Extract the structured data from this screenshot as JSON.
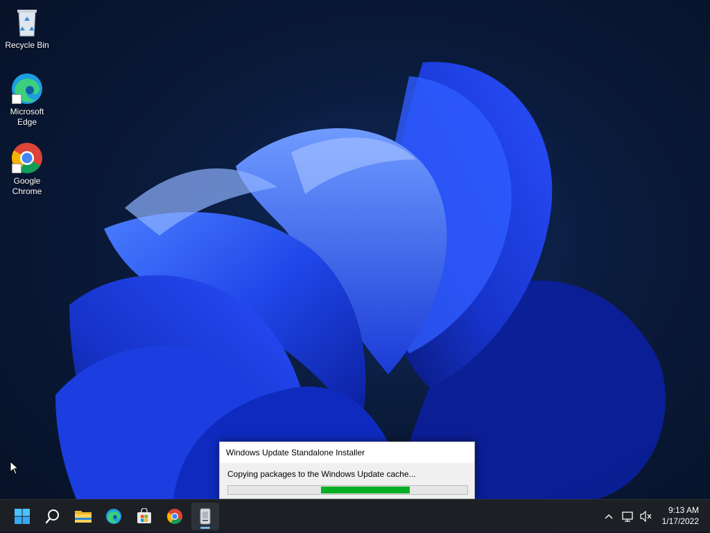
{
  "desktop": {
    "icons": [
      {
        "label": "Recycle Bin",
        "icon": "recycle-bin-icon"
      },
      {
        "label": "Microsoft Edge",
        "icon": "edge-icon"
      },
      {
        "label": "Google Chrome",
        "icon": "chrome-icon"
      }
    ]
  },
  "installer": {
    "title": "Windows Update Standalone Installer",
    "message": "Copying packages to the Windows Update cache...",
    "progress": 0.5
  },
  "taskbar": {
    "items": [
      {
        "icon": "windows-start-icon"
      },
      {
        "icon": "search-icon"
      },
      {
        "icon": "file-explorer-icon"
      },
      {
        "icon": "edge-icon"
      },
      {
        "icon": "microsoft-store-icon"
      },
      {
        "icon": "chrome-icon"
      },
      {
        "icon": "installer-app-icon",
        "active": true
      }
    ],
    "tray": {
      "icons": [
        "chevron-up-icon",
        "network-icon",
        "volume-muted-icon"
      ]
    },
    "clock": {
      "time": "9:13 AM",
      "date": "1/17/2022"
    }
  },
  "colors": {
    "progress": "#06b025",
    "accent": "#0067c0",
    "taskbar": "#1c1f24"
  }
}
